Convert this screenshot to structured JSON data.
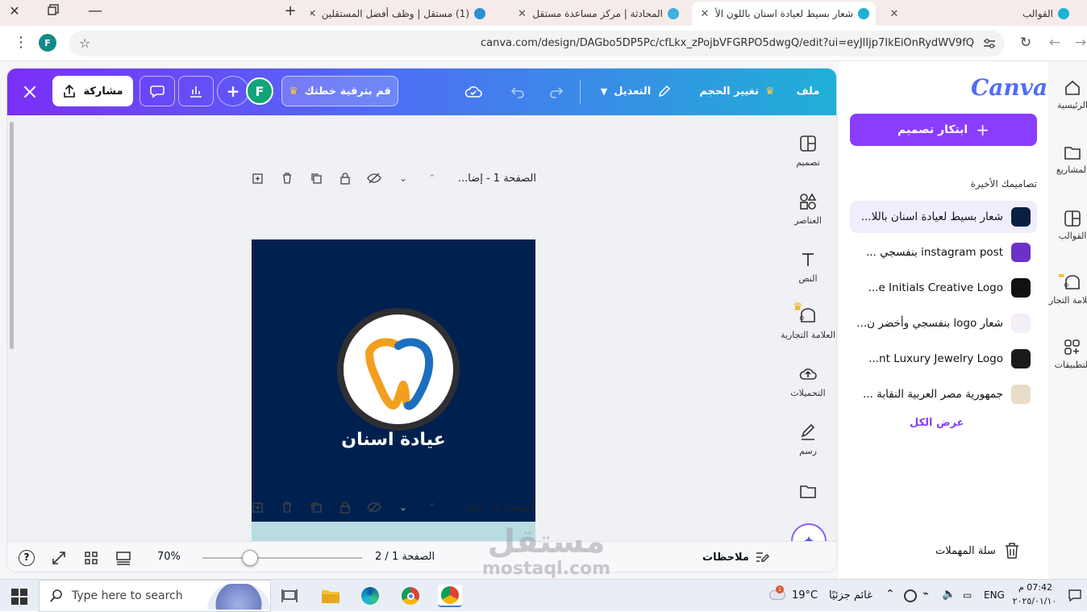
{
  "browser": {
    "tabs": [
      {
        "label": "القوالب"
      },
      {
        "label": "شعار بسيط لعيادة اسنان باللون الأ"
      },
      {
        "label": "المحادثة | مركز مساعدة مستقل"
      },
      {
        "label": "(1) مستقل | وظف أفضل المستقلين"
      }
    ],
    "url": "canva.com/design/DAGbo5DP5Pc/cfLkx_zPojbVFGRPO5dwgQ/edit?ui=eyJlIjp7IkEiOnRydWV9fQ",
    "profile_initial": "F"
  },
  "editor": {
    "menu_file": "ملف",
    "menu_resize": "تغيير الحجم",
    "menu_edit": "التعديل",
    "upgrade_label": "قم بترقية خطتك",
    "avatar_initial": "F",
    "share_label": "مشاركة",
    "tools": [
      {
        "label": "تصميم"
      },
      {
        "label": "العناصر"
      },
      {
        "label": "النص"
      },
      {
        "label": "العلامة التجارية"
      },
      {
        "label": "التحميلات"
      },
      {
        "label": "رسم"
      }
    ],
    "page1": {
      "title": "الصفحة 1 - إضا...",
      "logo_text": "عيادة اسنان"
    },
    "page2": {
      "title": "الصفحة 2 - إضا..."
    },
    "bottom": {
      "notes": "ملاحظات",
      "page_counter": "الصفحة 1 / 2",
      "zoom": "70%",
      "zoom_fraction": 0.3
    }
  },
  "right_panel": {
    "logo": "Canva",
    "create_label": "ابتكار تصميم",
    "recent_heading": "تصاميمك الأخيرة",
    "recent": [
      {
        "label": "شعار بسيط لعيادة اسنان باللا...",
        "color": "#0b1f44"
      },
      {
        "label": "instagram post بنفسجي ...",
        "color": "#6b32c9"
      },
      {
        "label": "e Initials Creative Logo...",
        "color": "#111111"
      },
      {
        "label": "شعار logo بنفسجي وأخضر ن...",
        "color": "#f4eef8"
      },
      {
        "label": "nt Luxury Jewelry Logo...",
        "color": "#1a1a1a"
      },
      {
        "label": "جمهورية مصر العربية النقابة ...",
        "color": "#e8dcc8"
      }
    ],
    "view_all": "عرض الكل",
    "trash": "سلة المهملات",
    "rail": [
      {
        "label": "الرئيسية"
      },
      {
        "label": "المشاريع"
      },
      {
        "label": "القوالب"
      },
      {
        "label": "العلامة التجارية"
      },
      {
        "label": "التطبيقات"
      }
    ]
  },
  "taskbar": {
    "search_placeholder": "Type here to search",
    "weather_temp": "19°C",
    "weather_desc": "غائم جزئيًا",
    "lang": "ENG",
    "time": "07:42 م",
    "date": "٢٠٢٥/٠١/١٠"
  },
  "watermark": {
    "arabic": "مستقل",
    "latin": "mostaql.com"
  }
}
